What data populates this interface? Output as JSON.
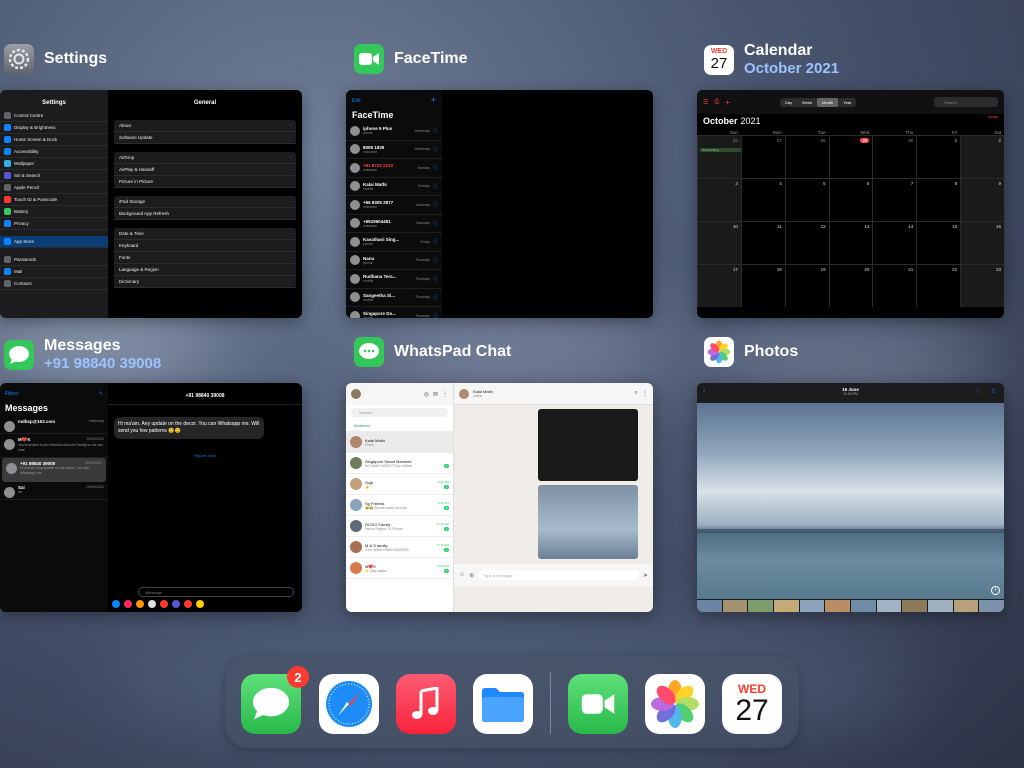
{
  "apps": {
    "settings": {
      "name": "Settings",
      "sidebar_header": "Settings",
      "detail_header": "General",
      "sidebar": [
        "Control Centre",
        "Display & Brightness",
        "Home Screen & Dock",
        "Accessibility",
        "Wallpaper",
        "Siri & Search",
        "Apple Pencil",
        "Touch ID & Passcode",
        "Battery",
        "Privacy",
        "App Store",
        "Passwords",
        "Mail",
        "Contacts"
      ],
      "groups": [
        [
          "About",
          "Software Update"
        ],
        [
          "AirDrop",
          "AirPlay & Handoff",
          "Picture in Picture"
        ],
        [
          "iPad Storage",
          "Background App Refresh"
        ],
        [
          "Date & Time",
          "Keyboard",
          "Fonts",
          "Language & Region",
          "Dictionary"
        ]
      ]
    },
    "facetime": {
      "name": "FaceTime",
      "edit": "Edit",
      "heading": "FaceTime",
      "calls": [
        {
          "name": "iphone 5 Plus",
          "sub": "phone",
          "day": "Yesterday"
        },
        {
          "name": "8008 1839",
          "sub": "unknown",
          "day": "Yesterday"
        },
        {
          "name": "+91 8722 2210",
          "sub": "unknown",
          "day": "Monday"
        },
        {
          "name": "Kalai Mathi",
          "sub": "mobile",
          "day": "Sunday"
        },
        {
          "name": "+65 9305 2877",
          "sub": "unknown",
          "day": "Saturday"
        },
        {
          "name": "+6519604481",
          "sub": "unknown",
          "day": "Saturday"
        },
        {
          "name": "Kavathani Sing...",
          "sub": "phone",
          "day": "Friday"
        },
        {
          "name": "Nanu",
          "sub": "phone",
          "day": "Thursday"
        },
        {
          "name": "Rudhana Tera...",
          "sub": "mobile",
          "day": "Thursday"
        },
        {
          "name": "Sangeetha Si...",
          "sub": "mobile",
          "day": "Thursday"
        },
        {
          "name": "Singapore Do...",
          "sub": "phone",
          "day": "Thursday"
        }
      ]
    },
    "calendar": {
      "name": "Calendar",
      "subtitle": "October 2021",
      "month": "October",
      "year": "2021",
      "views": [
        "Day",
        "Week",
        "Month",
        "Year"
      ],
      "search": "Search",
      "today": "Today",
      "weekdays": [
        "Sun",
        "Mon",
        "Tue",
        "Wed",
        "Thu",
        "Fri",
        "Sat"
      ],
      "weeks": [
        [
          "26",
          "27",
          "28",
          "29",
          "30",
          "1",
          "2"
        ],
        [
          "3",
          "4",
          "5",
          "6",
          "7",
          "8",
          "9"
        ],
        [
          "10",
          "11",
          "12",
          "13",
          "14",
          "15",
          "16"
        ],
        [
          "17",
          "18",
          "19",
          "20",
          "21",
          "22",
          "23"
        ]
      ],
      "marked_day": "29",
      "event": "Navratri Beg."
    },
    "messages": {
      "name": "Messages",
      "subtitle": "+91 98840 39008",
      "filters": "Filters",
      "heading": "Messages",
      "contact": "+91 98840 39008",
      "threads": [
        {
          "name": "mdbsp@163.com",
          "time": "Yesterday",
          "preview": ""
        },
        {
          "name": "M❤️K",
          "time": "23/09/2021",
          "preview": "You're invited to join Meshed Aaron's Family so we can chat"
        },
        {
          "name": "+91 98840 39008",
          "time": "15/09/2021",
          "preview": "Hi ma'am. Any update on the decor. You can Whatsapp me."
        },
        {
          "name": "Sai",
          "time": "03/09/2021",
          "preview": "ok"
        }
      ],
      "bubble": "Hi ma'am. Any update on the decor. You can Whatsapp me. Will send you few patterns 😊😊",
      "report": "Report Junk",
      "input": "iMessage"
    },
    "whatsapp": {
      "name": "WhatsPad Chat",
      "chat_name": "Kalai Mathi",
      "status": "online",
      "search": "Search",
      "archived": "Archived",
      "input": "Type a message",
      "chats": [
        {
          "name": "Kalai Mathi",
          "time": "",
          "preview": "Photo"
        },
        {
          "name": "Singapore Smart Mamees",
          "time": "",
          "preview": "NO MANY NOBOT! Curr rabbits",
          "badge": "1"
        },
        {
          "name": "Suja",
          "time": "9:41 PM",
          "preview": "👍",
          "badge": "1"
        },
        {
          "name": "Sg Friends",
          "time": "9:41 PM",
          "preview": "😂😂 Should would up cycle",
          "badge": "2"
        },
        {
          "name": "OLDIO Family",
          "time": "12:34 AM",
          "preview": "Reena Panjee: 31 Photos",
          "badge": "1"
        },
        {
          "name": "M & S family",
          "time": "12:10 AM",
          "preview": "Kavi: Which Fifteen BSDMGR",
          "badge": "1"
        },
        {
          "name": "M❤️K",
          "time": "10:00 AM",
          "preview": "⭐ play pattern",
          "badge": "1"
        }
      ]
    },
    "photos": {
      "name": "Photos",
      "top_label": "16 June",
      "top_sub": "11:09 PM"
    }
  },
  "dock": {
    "badge": "2",
    "calendar_day": "WED",
    "calendar_date": "27"
  },
  "calendar_icon": {
    "day": "WED",
    "date": "27"
  }
}
